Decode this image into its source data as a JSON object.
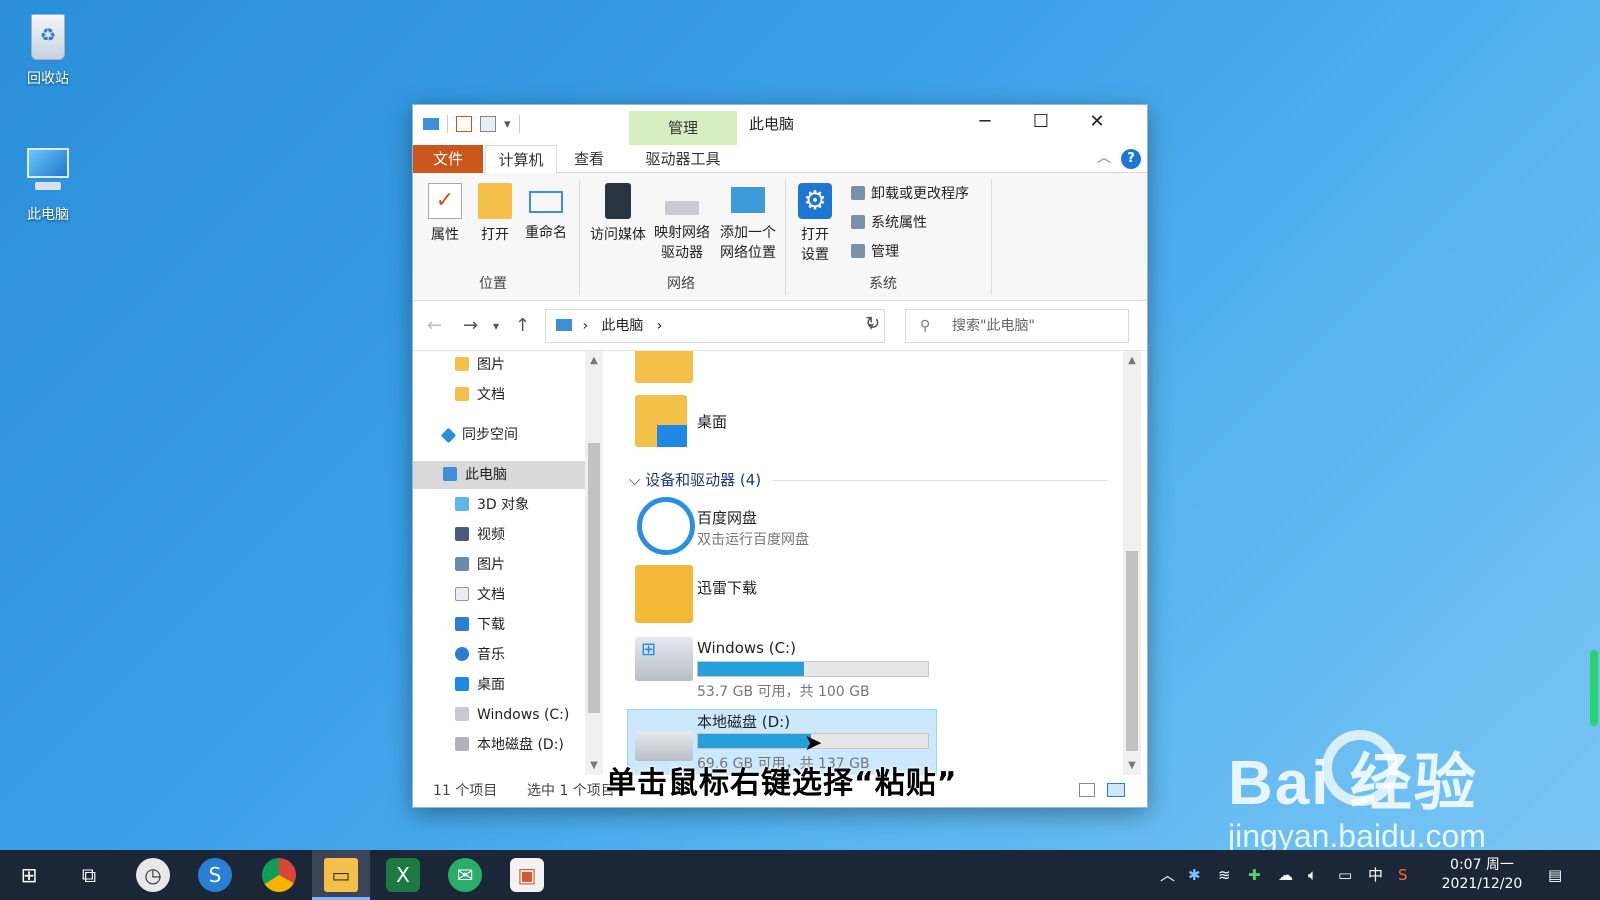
{
  "desktop": {
    "icons": [
      {
        "label": "回收站"
      },
      {
        "label": "此电脑"
      }
    ]
  },
  "window": {
    "title": "此电脑",
    "context_tab": "管理",
    "tabs": [
      {
        "label": "文件"
      },
      {
        "label": "计算机"
      },
      {
        "label": "查看"
      },
      {
        "label": "驱动器工具"
      }
    ],
    "ribbon": {
      "location_group": "位置",
      "network_group": "网络",
      "system_group": "系统",
      "properties": "属性",
      "open": "打开",
      "rename": "重命名",
      "access_media": "访问媒体",
      "map_drive_1": "映射网络",
      "map_drive_2": "驱动器",
      "add_location_1": "添加一个",
      "add_location_2": "网络位置",
      "open_settings_1": "打开",
      "open_settings_2": "设置",
      "uninstall": "卸载或更改程序",
      "sys_props": "系统属性",
      "manage": "管理"
    },
    "address": {
      "crumb": "此电脑",
      "search_placeholder": "搜索\"此电脑\""
    },
    "nav_items": [
      {
        "label": "图片"
      },
      {
        "label": "文档"
      },
      {
        "label": "同步空间"
      },
      {
        "label": "此电脑"
      },
      {
        "label": "3D 对象"
      },
      {
        "label": "视频"
      },
      {
        "label": "图片"
      },
      {
        "label": "文档"
      },
      {
        "label": "下载"
      },
      {
        "label": "音乐"
      },
      {
        "label": "桌面"
      },
      {
        "label": "Windows (C:)"
      },
      {
        "label": "本地磁盘 (D:)"
      }
    ],
    "main": {
      "desktop_folder": "桌面",
      "group_header": "设备和驱动器 (4)",
      "baidu_name": "百度网盘",
      "baidu_sub": "双击运行百度网盘",
      "xunlei_name": "迅雷下载",
      "c_name": "Windows (C:)",
      "c_info": "53.7 GB 可用，共 100 GB",
      "c_used_fraction": 0.463,
      "d_name": "本地磁盘 (D:)",
      "d_info": "69.6 GB 可用，共 137 GB",
      "d_used_fraction": 0.492
    },
    "status": {
      "count": "11 个项目",
      "selected": "选中 1 个项目"
    }
  },
  "caption": "单击鼠标右键选择“粘贴”",
  "watermark": {
    "brand": "Bai  经验",
    "url": "jingyan.baidu.com"
  },
  "taskbar": {
    "ime": "中",
    "time": "0:07 周一",
    "date": "2021/12/20"
  },
  "colors": {
    "file_tab": "#c9561a",
    "context_tab": "#d6efc1",
    "drive_bar": "#26a0da",
    "selection": "#cce8ff"
  }
}
